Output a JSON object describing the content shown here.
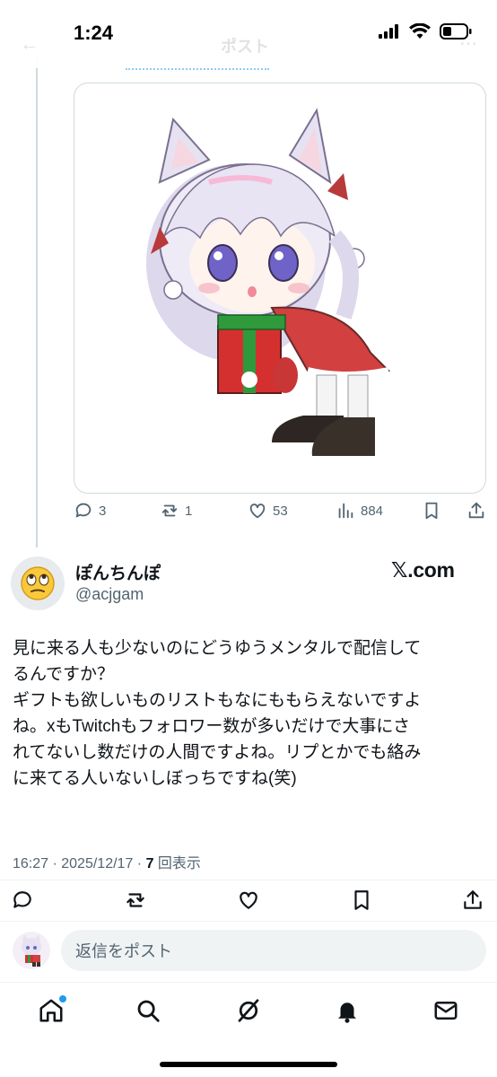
{
  "status_bar": {
    "time": "1:24"
  },
  "header": {
    "title": "ポスト"
  },
  "parent_post": {
    "actions": {
      "replies": "3",
      "reposts": "1",
      "likes": "53",
      "views": "884"
    }
  },
  "post": {
    "display_name": "ぽんちんぽ",
    "handle": "@acjgam",
    "source_badge": "𝕏.com",
    "body_lines": [
      "見に来る人も少ないのにどうゆうメンタルで配信して",
      "るんですか？",
      "ギフトも欲しいものリストもなにももらえないですよ",
      "ね。xもTwitchもフォロワー数が多いだけで大事にさ",
      "れてないし数だけの人間ですよね。リプとかでも絡み",
      "に来てる人いないしぼっちですね(笑)"
    ],
    "timestamp": "16:27 · 2025/12/17 · ",
    "views_count": "7",
    "views_label": " 回表示"
  },
  "reply": {
    "placeholder": "返信をポスト"
  },
  "colors": {
    "accent": "#1d9bf0",
    "text_secondary": "#536471",
    "border": "#cfd9de"
  }
}
